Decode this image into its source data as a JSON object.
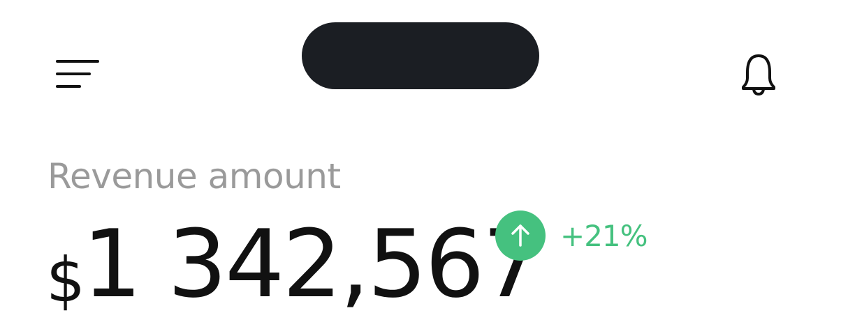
{
  "header": {
    "menu_icon": "menu-icon",
    "notification_icon": "bell-icon"
  },
  "revenue": {
    "label": "Revenue amount",
    "currency_symbol": "$",
    "amount": "1 342,567",
    "trend_icon": "arrow-up-icon",
    "change": "+21%"
  },
  "colors": {
    "positive": "#45c17f",
    "notch": "#1b1e23",
    "label": "#9a9a9a",
    "text": "#111111"
  }
}
